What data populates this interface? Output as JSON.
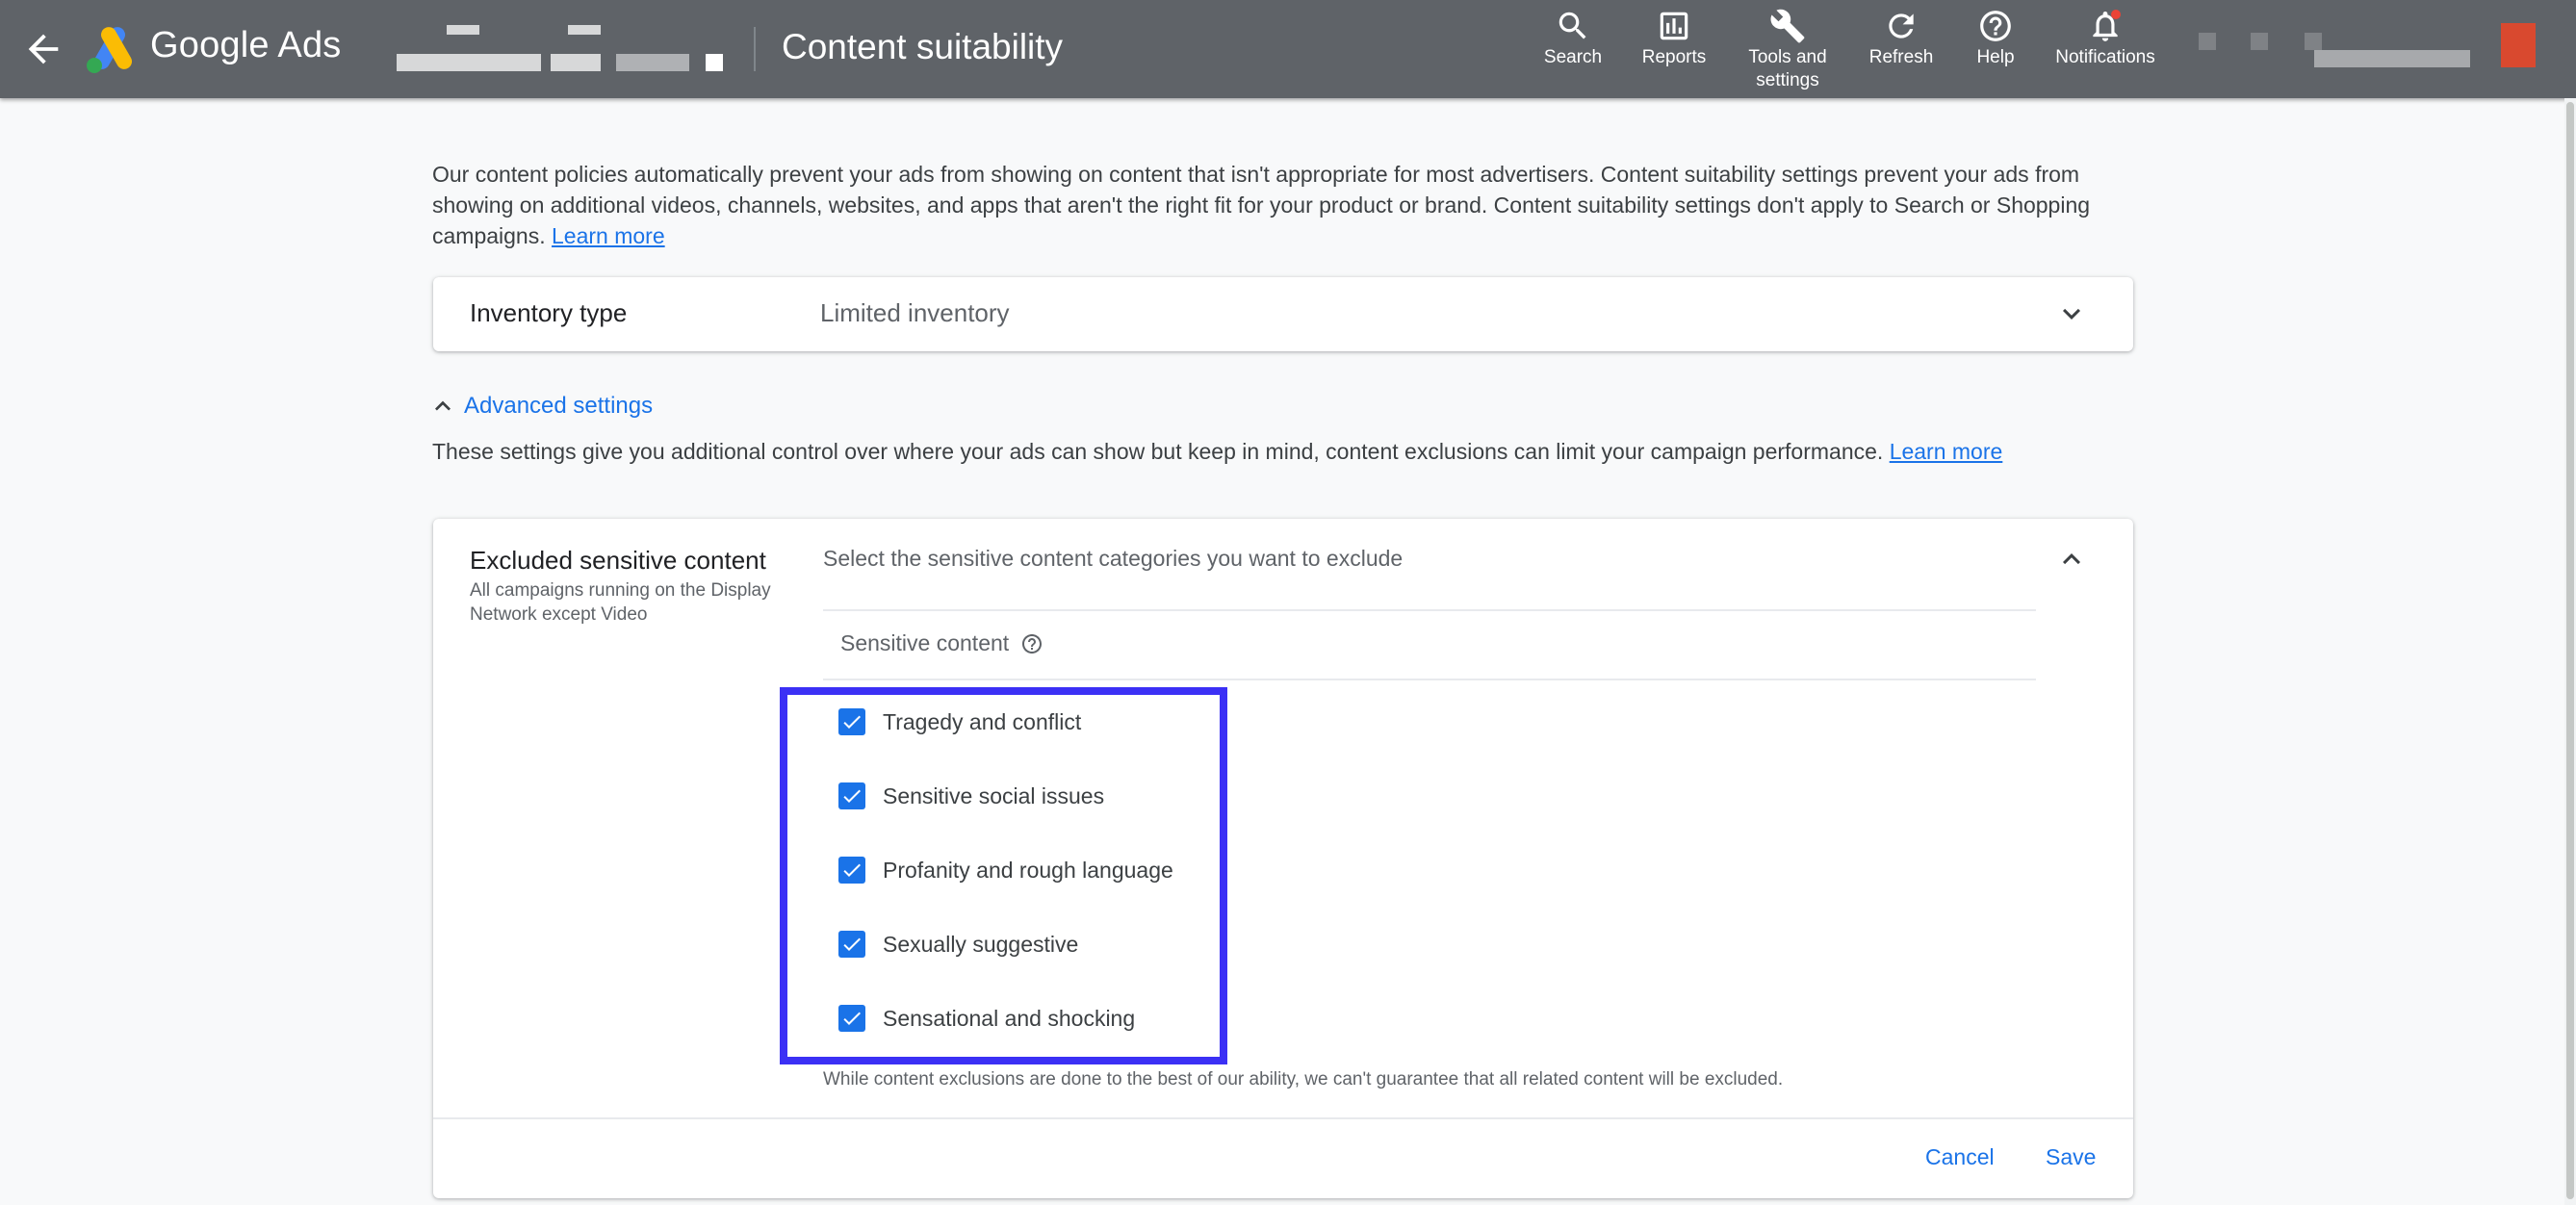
{
  "header": {
    "brand": "Google Ads",
    "page_title": "Content suitability",
    "nav": [
      {
        "label": "Search",
        "icon": "search-icon"
      },
      {
        "label": "Reports",
        "icon": "reports-icon"
      },
      {
        "label": "Tools and\nsettings",
        "icon": "wrench-icon"
      },
      {
        "label": "Refresh",
        "icon": "refresh-icon"
      },
      {
        "label": "Help",
        "icon": "help-icon"
      },
      {
        "label": "Notifications",
        "icon": "bell-icon"
      }
    ],
    "colors": {
      "bar": "#5f6368",
      "notification_dot": "#ea4335"
    }
  },
  "intro": {
    "text": "Our content policies automatically prevent your ads from showing on content that isn't appropriate for most advertisers. Content suitability settings prevent your ads from showing on additional videos, channels, websites, and apps that aren't the right fit for your product or brand. Content suitability settings don't apply to Search or Shopping campaigns. ",
    "link": "Learn more"
  },
  "inventory": {
    "label": "Inventory type",
    "value": "Limited inventory"
  },
  "advanced": {
    "toggle_label": "Advanced settings",
    "description": "These settings give you additional control over where your ads can show but keep in mind, content exclusions can limit your campaign performance. ",
    "link": "Learn more"
  },
  "excluded": {
    "title": "Excluded sensitive content",
    "subtitle": "All campaigns running on the Display Network except Video",
    "instruction": "Select the sensitive content categories you want to exclude",
    "column_header": "Sensitive content",
    "categories": [
      {
        "label": "Tragedy and conflict",
        "checked": true
      },
      {
        "label": "Sensitive social issues",
        "checked": true
      },
      {
        "label": "Profanity and rough language",
        "checked": true
      },
      {
        "label": "Sexually suggestive",
        "checked": true
      },
      {
        "label": "Sensational and shocking",
        "checked": true
      }
    ],
    "note": "While content exclusions are done to the best of our ability, we can't guarantee that all related content will be excluded.",
    "cancel_label": "Cancel",
    "save_label": "Save"
  },
  "colors": {
    "accent": "#1a73e8",
    "highlight_box": "#3b30f5"
  }
}
